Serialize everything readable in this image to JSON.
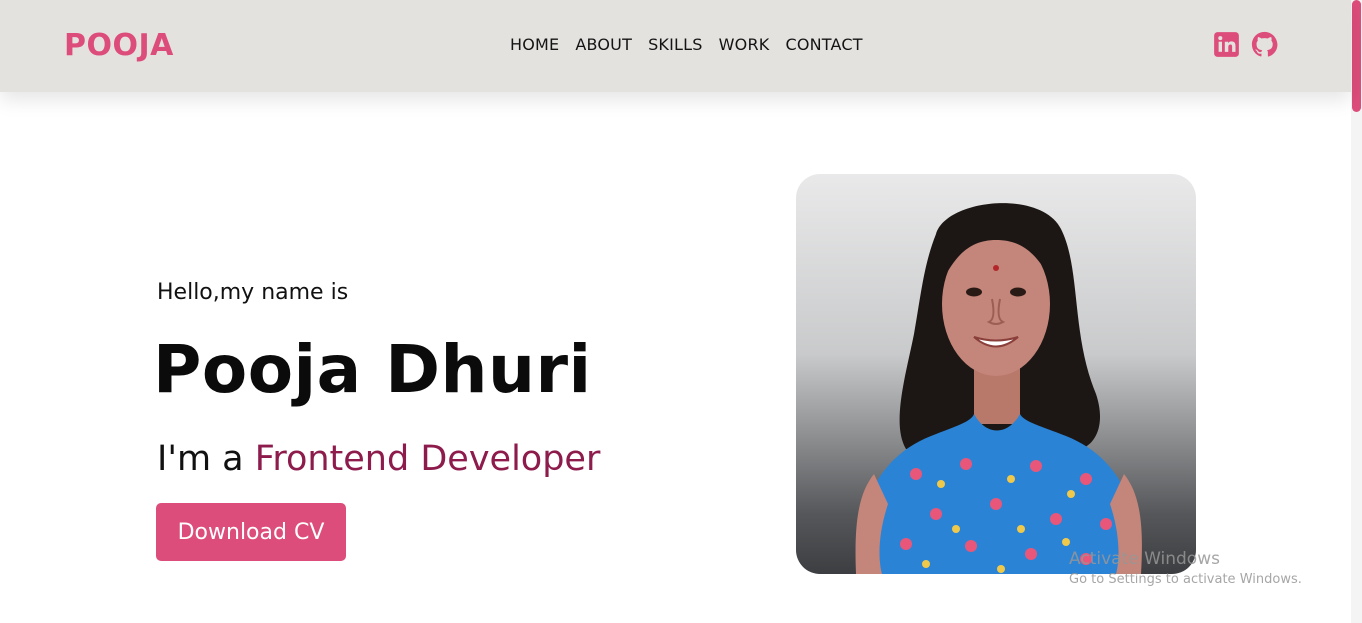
{
  "brand": {
    "name": "POOJA"
  },
  "nav": {
    "items": [
      {
        "label": "HOME"
      },
      {
        "label": "ABOUT"
      },
      {
        "label": "SKILLS"
      },
      {
        "label": "WORK"
      },
      {
        "label": "CONTACT"
      }
    ]
  },
  "socials": [
    {
      "icon": "linkedin-icon",
      "color": "#dd4d7b"
    },
    {
      "icon": "github-icon",
      "color": "#dd4d7b"
    }
  ],
  "hero": {
    "greeting": "Hello,my name is",
    "name": "Pooja Dhuri",
    "role_prefix": "I'm a ",
    "role_highlight": "Frontend Developer",
    "cv_button": "Download CV"
  },
  "profile_photo": {
    "description_icon": "portrait-photo"
  },
  "watermark": {
    "title": "Activate Windows",
    "subtitle": "Go to Settings to activate Windows."
  },
  "colors": {
    "accent": "#dd4d7b",
    "role_accent": "#8d1c4d",
    "navbar_bg": "#e4e2df"
  }
}
